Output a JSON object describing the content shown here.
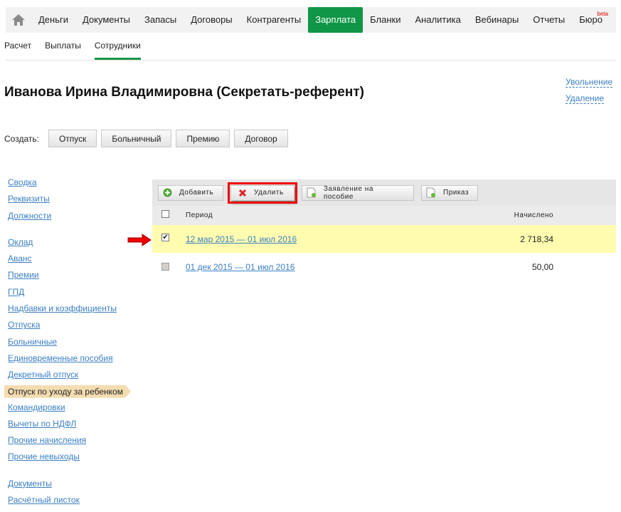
{
  "nav": {
    "items": [
      "Деньги",
      "Документы",
      "Запасы",
      "Договоры",
      "Контрагенты",
      "Зарплата",
      "Бланки",
      "Аналитика",
      "Вебинары",
      "Отчеты",
      "Бюро"
    ],
    "active": "Зарплата",
    "beta": "beta"
  },
  "subtabs": [
    "Расчет",
    "Выплаты",
    "Сотрудники"
  ],
  "title": "Иванова Ирина Владимировна (Секретать-референт)",
  "actions": {
    "dismiss": "Увольнение",
    "delete": "Удаление"
  },
  "create": {
    "label": "Создать:",
    "buttons": [
      "Отпуск",
      "Больничный",
      "Премию",
      "Договор"
    ]
  },
  "sidebar": {
    "group1": [
      "Сводка",
      "Реквизиты",
      "Должности"
    ],
    "group2": [
      "Оклад",
      "Аванс",
      "Премии",
      "ГПД",
      "Надбавки и коэффициенты",
      "Отпуска",
      "Больничные",
      "Единовременные пособия",
      "Декретный отпуск",
      "Отпуск по уходу за ребенком",
      "Командировки",
      "Вычеты по НДФЛ",
      "Прочие начисления",
      "Прочие невыходы"
    ],
    "group3": [
      "Документы",
      "Расчётный листок"
    ],
    "active": "Отпуск по уходу за ребенком"
  },
  "toolbar": {
    "add": "Добавить",
    "delete": "Удалить",
    "application": "Заявление на пособие",
    "order": "Приказ"
  },
  "table": {
    "headers": [
      "Период",
      "Начислено"
    ],
    "rows": [
      {
        "period": "12 мар 2015 — 01 июл 2016",
        "amount": "2 718,34",
        "checked": true
      },
      {
        "period": "01 дек 2015 — 01 июл 2016",
        "amount": "50,00",
        "checked": false
      }
    ]
  },
  "colors": {
    "accent": "#0f9647",
    "link": "#3b7fc4",
    "selected_row": "#fffcb0"
  }
}
